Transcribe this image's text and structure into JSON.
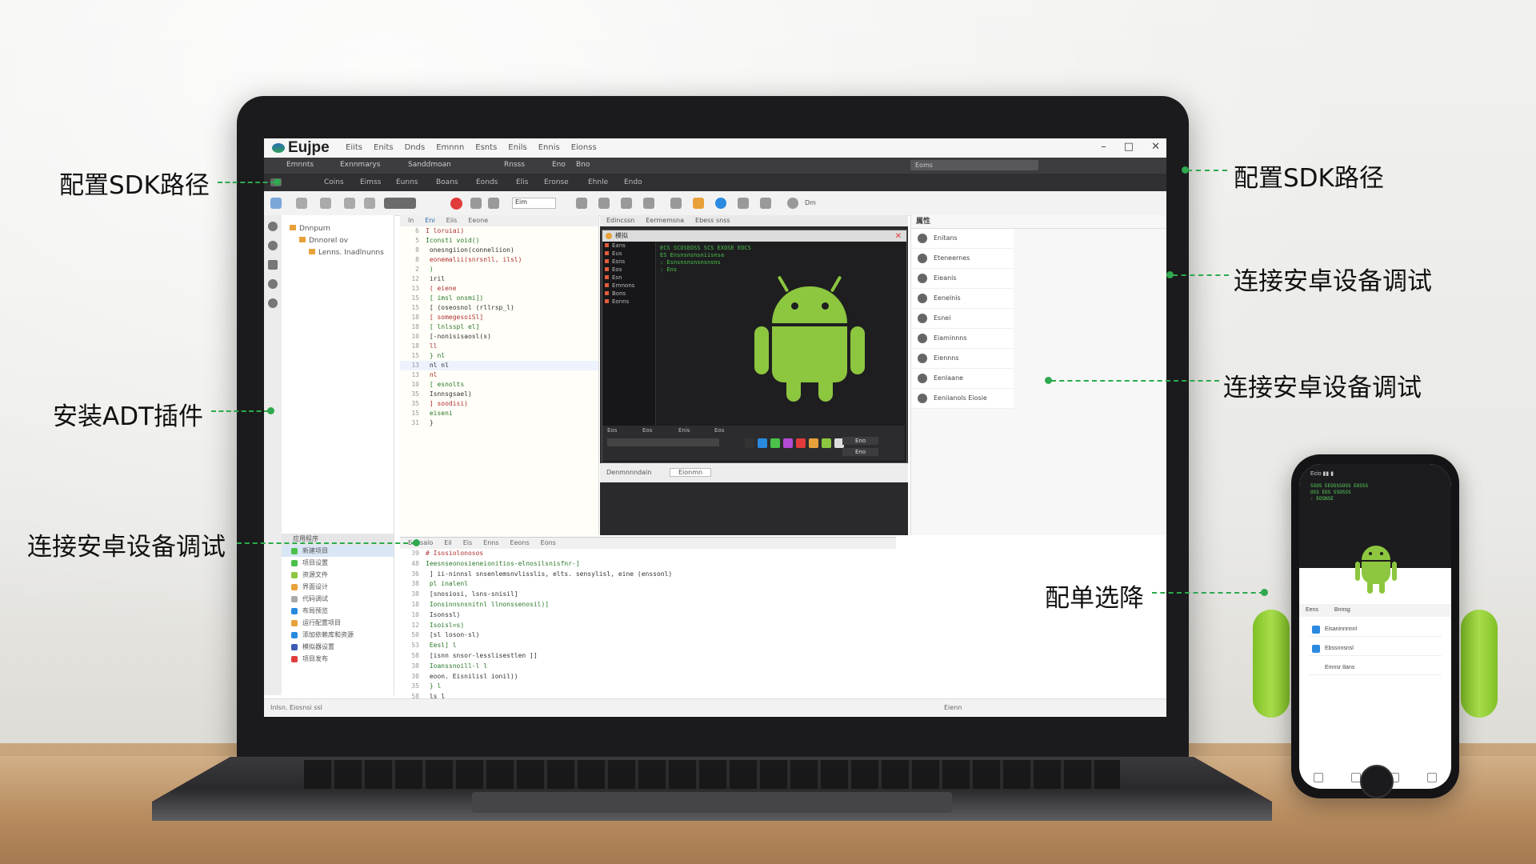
{
  "app": {
    "title": "Eujpe",
    "menu": [
      "Eiits",
      "Enits",
      "Dnds",
      "Emnnn",
      "Esnts",
      "Enils",
      "Ennis",
      "Eionss"
    ]
  },
  "toolbar1": {
    "items": [
      "Emnnts",
      "Exnnmarys",
      "Sanddmoan",
      "Rnsss",
      "Eno",
      "Bno"
    ],
    "search_placeholder": "Eoms"
  },
  "toolbar2": {
    "items": [
      "Coins",
      "Eimss",
      "Eunns",
      "Boans",
      "Eonds",
      "Elis",
      "Eronse",
      "Ehnle",
      "Endo"
    ]
  },
  "toolbar3": {
    "combo_value": "Eim",
    "label": "Dm"
  },
  "explorer": {
    "tree": [
      "Dnnpurn",
      "Dnnorel ov",
      "Lenns. Inadlnunns"
    ],
    "list_header": "应用程序",
    "list_items": [
      "新建项目",
      "项目设置",
      "资源文件",
      "界面设计",
      "代码调试",
      "布局预览",
      "运行配置项目",
      "添加依赖库和资源",
      "模拟器设置",
      "项目发布"
    ]
  },
  "editor": {
    "tabs": [
      "ln",
      "Eni",
      "Eiis",
      "Eeone"
    ],
    "lines": [
      {
        "n": "6",
        "t": "I loruiai)"
      },
      {
        "n": "5",
        "t": "Iconsti void()"
      },
      {
        "n": "8",
        "t": "  onesngiion(conneliion)"
      },
      {
        "n": "8",
        "t": "  eonemalii(snrsnll, ilsl)"
      },
      {
        "n": "2",
        "t": "  )"
      },
      {
        "n": "12",
        "t": " iril"
      },
      {
        "n": "13",
        "t": "  ( eiene"
      },
      {
        "n": "15",
        "t": "  [ imsl onsmi])"
      },
      {
        "n": "15",
        "t": "  [ (oseosnol (rllrsp_l)"
      },
      {
        "n": "18",
        "t": "  [ somegesoiSl]"
      },
      {
        "n": "18",
        "t": "  [ lnlsspl  el]"
      },
      {
        "n": "10",
        "t": "  [-nonisisaosl(s)"
      },
      {
        "n": "18",
        "t": "  ll"
      },
      {
        "n": "15",
        "t": " } nl"
      },
      {
        "n": "13",
        "t": "  nl nl"
      },
      {
        "n": "13",
        "t": "  nl"
      },
      {
        "n": "10",
        "t": "  [ esnolts"
      },
      {
        "n": "35",
        "t": "  Isnnsgsael)"
      },
      {
        "n": "35",
        "t": "  ]   soodisi)"
      },
      {
        "n": "15",
        "t": "  eiseni"
      },
      {
        "n": "31",
        "t": "  }"
      }
    ]
  },
  "emulator": {
    "tabs": [
      "Edincssn",
      "Eermemsna",
      "Ebess snss"
    ],
    "window_title": "模拟",
    "side_rows": [
      "Eans",
      "Eus",
      "Esns",
      "Eos",
      "Esn",
      "Ernnons",
      "Bons",
      "Eonns"
    ],
    "log": [
      "ECS SCOSEOSS SCS EXOSE EOCS",
      "ES Ensnsnsnsniisnsa",
      "  : Esnsnsnsnsnsnsns",
      "  : Ens"
    ],
    "bottom_labels": [
      "Eos",
      "Eos",
      "Enis",
      "Eos"
    ],
    "bottom_value1": "Eno",
    "bottom_value2": "Eno",
    "footer": [
      "Denmnnndain",
      "Eionmn"
    ],
    "color_swatches": [
      "#333333",
      "#2a8ae0",
      "#4ac14a",
      "#b44ad6",
      "#e23b3b",
      "#e8a13a",
      "#8dc63f",
      "#dddddd"
    ]
  },
  "props": {
    "header": "属性",
    "rows": [
      "Enitans",
      "Eteneernes",
      "Eieanis",
      "Eenelnis",
      "Esnei",
      "Eiaminnns",
      "Eiennns",
      "Eenlaane",
      "Eeniianols Eiosie"
    ]
  },
  "console": {
    "tabs": [
      "Eonsalo",
      "Eil",
      "Eis",
      "Enns",
      "Eeons",
      "Eons"
    ],
    "lines": [
      {
        "n": "39",
        "t": "# Isosiolonosos"
      },
      {
        "n": "48",
        "t": "Ieesnseonosieneionitios-elnosilsnisfnr-]"
      },
      {
        "n": "36",
        "t": "  ] ii-ninnsl snsenlemsnvlisslis, elts. sensylisl, eine (enssonl)"
      },
      {
        "n": "38",
        "t": "  pl inalenl"
      },
      {
        "n": "38",
        "t": "    [snosiosi, lsns-snisil]"
      },
      {
        "n": "18",
        "t": "    Ionsinnsnsnitnl llnonssenosil)]"
      },
      {
        "n": "10",
        "t": "      Isonssl)"
      },
      {
        "n": "12",
        "t": "      Isoisl=s)"
      },
      {
        "n": "50",
        "t": "    [sl loson-sl)"
      },
      {
        "n": "53",
        "t": "    Eesl] l"
      },
      {
        "n": "58",
        "t": "      [isnn snsor-lesslisestlen ]]"
      },
      {
        "n": "38",
        "t": "      Ioanssnoill-l l"
      },
      {
        "n": "38",
        "t": "      eoon. Eisnilisl ionil))"
      },
      {
        "n": "35",
        "t": "    }  l"
      },
      {
        "n": "58",
        "t": "  ls l"
      }
    ]
  },
  "statusbar": {
    "left": "Inlsn. Eiosnsi ssl",
    "right": "Eienn"
  },
  "phone": {
    "status": "Ecio                  ▮▮ ▮",
    "log": [
      "SSOS EEOSSSOSS EOSSS",
      "OSS EOS SSOSSS",
      "  : EOSNSE"
    ],
    "bar_left": "Eens",
    "bar_right": "Bnnsg",
    "items": [
      "Eisaninnnnnl",
      "Ebssnnsnsl",
      "Emnsr 8ans"
    ]
  },
  "callouts": {
    "left_top": "配置SDK路径",
    "left_mid": "安装ADT插件",
    "left_bottom": "连接安卓设备调试",
    "right_top": "配置SDK路径",
    "right_mid1": "连接安卓设备调试",
    "right_mid2": "连接安卓设备调试",
    "right_bottom": "配单选降"
  },
  "colors": {
    "accent_green": "#2fa84f",
    "android_green": "#8dc63f",
    "run_red": "#e23b3b"
  }
}
